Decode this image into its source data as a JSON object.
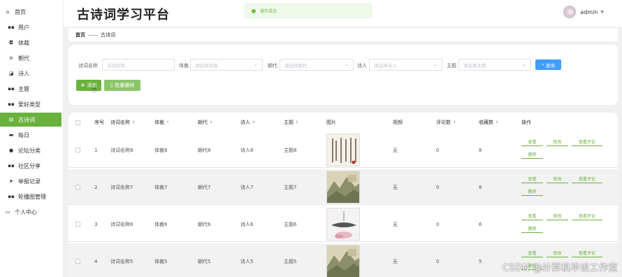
{
  "app": {
    "title": "古诗词学习平台"
  },
  "toast": {
    "message": "操作成功"
  },
  "user": {
    "name": "admin"
  },
  "sidebar": {
    "items": [
      {
        "label": "首页",
        "icon": "home-icon",
        "glyph": "⌂"
      },
      {
        "label": "用户",
        "icon": "grid-icon",
        "glyph": "▪▪"
      },
      {
        "label": "体裁",
        "icon": "square-icon",
        "glyph": "◘"
      },
      {
        "label": "朝代",
        "icon": "list-icon",
        "glyph": "≡"
      },
      {
        "label": "诗人",
        "icon": "message-icon",
        "glyph": "◪"
      },
      {
        "label": "主题",
        "icon": "grid-icon",
        "glyph": "▪▪"
      },
      {
        "label": "爱好类型",
        "icon": "grid-icon",
        "glyph": "▪▪"
      },
      {
        "label": "古诗词",
        "icon": "document-icon",
        "glyph": "▤"
      },
      {
        "label": "每日",
        "icon": "monitor-icon",
        "glyph": "▬"
      },
      {
        "label": "论坛分类",
        "icon": "user-icon",
        "glyph": "●"
      },
      {
        "label": "社区分享",
        "icon": "grid-icon",
        "glyph": "▪▪"
      },
      {
        "label": "举报记录",
        "icon": "send-icon",
        "glyph": "➤"
      },
      {
        "label": "轮播图管理",
        "icon": "grid-icon",
        "glyph": "▪▪"
      },
      {
        "label": "个人中心",
        "icon": "user-card-icon",
        "glyph": "▭"
      }
    ],
    "active_index": 7
  },
  "breadcrumb": {
    "home": "首页",
    "separator": "——",
    "current": "古诗词"
  },
  "filters": {
    "name": {
      "label": "诗词名称",
      "placeholder": "诗词名称"
    },
    "genre": {
      "label": "体裁",
      "placeholder": "请选择体裁"
    },
    "dynasty": {
      "label": "朝代",
      "placeholder": "请选择朝代"
    },
    "poet": {
      "label": "诗人",
      "placeholder": "请选择诗人"
    },
    "theme": {
      "label": "主题",
      "placeholder": "请选择主题"
    },
    "search_button": "查询",
    "add_button": "添加",
    "batch_delete_button": "批量删除"
  },
  "table": {
    "headers": [
      "序号",
      "诗词名称",
      "体裁",
      "朝代",
      "诗人",
      "主题",
      "图片",
      "视频",
      "评论数",
      "收藏数",
      "操作"
    ],
    "rows": [
      {
        "index": "1",
        "name": "诗词名称8",
        "genre": "体裁8",
        "dynasty": "朝代8",
        "poet": "诗人8",
        "theme": "主题8",
        "video": "无",
        "comments": "0",
        "favorites": "8",
        "image": "calligraphy"
      },
      {
        "index": "2",
        "name": "诗词名称7",
        "genre": "体裁7",
        "dynasty": "朝代7",
        "poet": "诗人7",
        "theme": "主题7",
        "video": "无",
        "comments": "0",
        "favorites": "8",
        "image": "landscape"
      },
      {
        "index": "3",
        "name": "诗词名称6",
        "genre": "体裁6",
        "dynasty": "朝代6",
        "poet": "诗人6",
        "theme": "主题6",
        "video": "无",
        "comments": "0",
        "favorites": "6",
        "image": "lotus"
      },
      {
        "index": "4",
        "name": "诗词名称5",
        "genre": "体裁5",
        "dynasty": "朝代5",
        "poet": "诗人5",
        "theme": "主题5",
        "video": "无",
        "comments": "0",
        "favorites": "5",
        "image": "landscape"
      }
    ],
    "actions": {
      "view": "查看",
      "edit": "修改",
      "view_comments": "查看评论",
      "delete": "删除"
    }
  },
  "watermark": "CSDN @计算机毕设工作室",
  "colors": {
    "primary": "#6bb13e",
    "search": "#409eff",
    "toast_text": "#67c23a"
  }
}
